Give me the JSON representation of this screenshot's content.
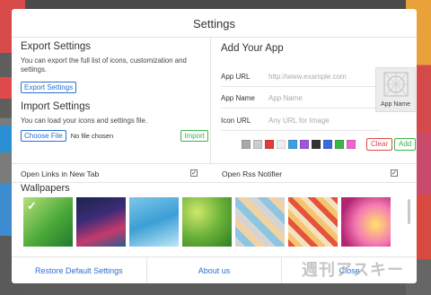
{
  "dialog": {
    "title": "Settings"
  },
  "export": {
    "heading": "Export Settings",
    "description": "You can export the full list of icons, customization and settings.",
    "button_label": "Export Settings"
  },
  "import": {
    "heading": "Import Settings",
    "description": "You can load your icons and settings file.",
    "choose_file_label": "Choose File",
    "file_status": "No file chosen",
    "import_label": "Import"
  },
  "add_app": {
    "heading": "Add Your App",
    "fields": [
      {
        "label": "App URL",
        "placeholder": "http://www.example.com"
      },
      {
        "label": "App Name",
        "placeholder": "App Name"
      },
      {
        "label": "Icon URL",
        "placeholder": "Any URL for Image"
      }
    ],
    "preview_label": "App Name",
    "swatch_colors": [
      "#aaaaaa",
      "#cccccc",
      "#e03c3c",
      "#eeeeee",
      "#3aa0e0",
      "#9b59d6",
      "#333333",
      "#3c6be0",
      "#3bb54a",
      "#ee66cc"
    ],
    "clear_label": "Clear",
    "add_label": "Add"
  },
  "options": {
    "open_links_label": "Open Links in New Tab",
    "open_links_checked": true,
    "rss_label": "Open Rss Notifier",
    "rss_checked": true
  },
  "wallpapers": {
    "heading": "Wallpapers",
    "selected_index": 0,
    "count": 7
  },
  "footer": {
    "restore_label": "Restore Default Settings",
    "about_label": "About us",
    "close_label": "Close"
  },
  "watermark": "週刊アスキー"
}
